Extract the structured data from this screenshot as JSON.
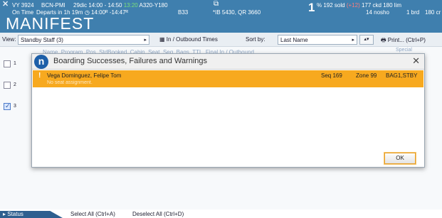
{
  "flight": {
    "close_icon": "x-icon",
    "number": "VY 3924",
    "route": "BCN-PMI",
    "schedule_prefix": "29dic 14:00 - 14:50",
    "schedule_actual": "13:20",
    "aircraft": "A320-Y180",
    "status": "On Time",
    "departs": "Departs in 1h 19m",
    "clock_times": "14:00ᴿ -14:47ᴿ",
    "gate": "B33",
    "codeshare": "*IB 5430, QR 3660",
    "big_number": "1",
    "pct_sold": "% 192 sold",
    "sold_delta": "(+12)",
    "ckd": "177 ckd",
    "capacity": "180 lim",
    "nosho": "14 nosho",
    "bird": "1 brd",
    "capacity2": "180 cr"
  },
  "app": {
    "title": "MANIFEST"
  },
  "toolbar": {
    "view_label": "View:",
    "view_value": "Standby Staff (3)",
    "inout_label": "In / Outbound Times",
    "sort_label": "Sort by:",
    "sort_value": "Last Name",
    "print_label": "Print... (Ctrl+P)"
  },
  "list": {
    "header": "Name, Program, Pos, StdBooked, Cabin, Seat, Seq, Bags, TTL, Final In / Outbound",
    "special": "Special",
    "rows": [
      "1",
      "2",
      "3"
    ]
  },
  "dialog": {
    "title": "Boarding Successes, Failures and Warnings",
    "passenger": "Vega Dominguez, Felipe Tom",
    "note": "No seat assignment.",
    "seq": "Seq 169",
    "zone": "Zone 99",
    "bag": "BAG1,STBY",
    "ok_label": "OK"
  },
  "status": {
    "tab": "Status",
    "select_all": "Select All (Ctrl+A)",
    "deselect_all": "Deselect All (Ctrl+D)"
  }
}
